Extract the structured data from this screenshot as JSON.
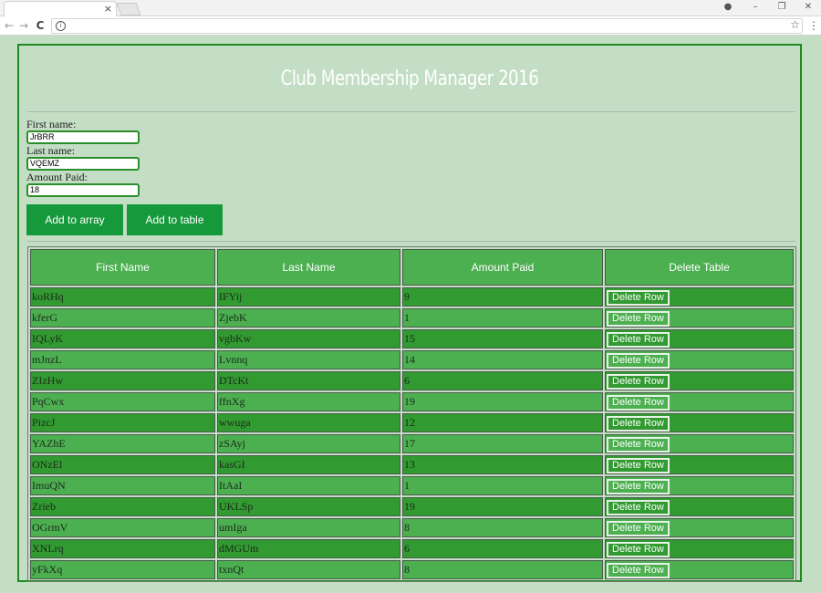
{
  "browser": {
    "tab_close": "×",
    "back_icon": "←",
    "forward_icon": "→",
    "reload_icon": "C",
    "info_icon": "i",
    "star_icon": "☆",
    "menu_icon": "⋮",
    "window_controls": {
      "profile": "●",
      "minimize": "–",
      "restore": "❐",
      "close": "✕"
    }
  },
  "page": {
    "title": "Club Membership Manager 2016"
  },
  "form": {
    "first_name_label": "First name:",
    "first_name_value": "JrBRR",
    "last_name_label": "Last name:",
    "last_name_value": "VQEMZ",
    "amount_label": "Amount Paid:",
    "amount_value": "18"
  },
  "buttons": {
    "add_array": "Add to array",
    "add_table": "Add to table",
    "delete_row": "Delete Row"
  },
  "table": {
    "headers": [
      "First Name",
      "Last Name",
      "Amount Paid",
      "Delete Table"
    ],
    "rows": [
      [
        "koRHq",
        "IFYij",
        "9"
      ],
      [
        "kferG",
        "ZjebK",
        "1"
      ],
      [
        "IQLyK",
        "vgbKw",
        "15"
      ],
      [
        "mJnzL",
        "Lvnnq",
        "14"
      ],
      [
        "ZIzHw",
        "DTcKt",
        "6"
      ],
      [
        "PqCwx",
        "ffnXg",
        "19"
      ],
      [
        "PizcJ",
        "wwuga",
        "12"
      ],
      [
        "YAZhE",
        "zSAyj",
        "17"
      ],
      [
        "ONzEl",
        "kasGI",
        "13"
      ],
      [
        "ImuQN",
        "ItAaI",
        "1"
      ],
      [
        "Zrieb",
        "UKLSp",
        "19"
      ],
      [
        "OGrmV",
        "umIga",
        "8"
      ],
      [
        "XNLrq",
        "dMGUm",
        "6"
      ],
      [
        "yFkXq",
        "txnQt",
        "8"
      ]
    ]
  }
}
